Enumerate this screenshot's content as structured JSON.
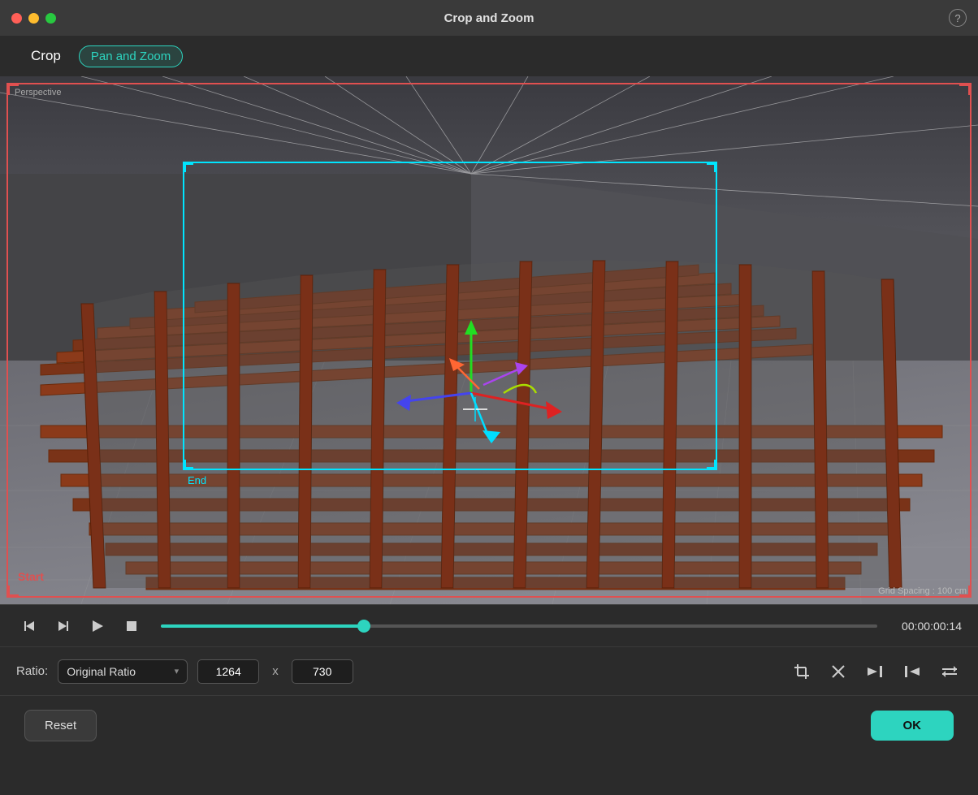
{
  "window": {
    "title": "Crop and Zoom",
    "help_label": "?"
  },
  "tabs": {
    "crop_label": "Crop",
    "panzoom_label": "Pan and Zoom"
  },
  "viewport": {
    "perspective_label": "Perspective",
    "start_label": "Start",
    "end_label": "End",
    "grid_spacing_label": "Grid Spacing : 100 cm"
  },
  "transport": {
    "timecode": "00:00:00:14",
    "scrubber_value": 28
  },
  "ratio": {
    "label": "Ratio:",
    "selected": "Original Ratio",
    "width": "1264",
    "height": "730",
    "x_label": "x"
  },
  "toolbar_icons": {
    "cut": "⌖",
    "close": "✕",
    "align_right": "⇥",
    "align_left": "⇤",
    "swap": "⇐"
  },
  "buttons": {
    "reset_label": "Reset",
    "ok_label": "OK"
  }
}
